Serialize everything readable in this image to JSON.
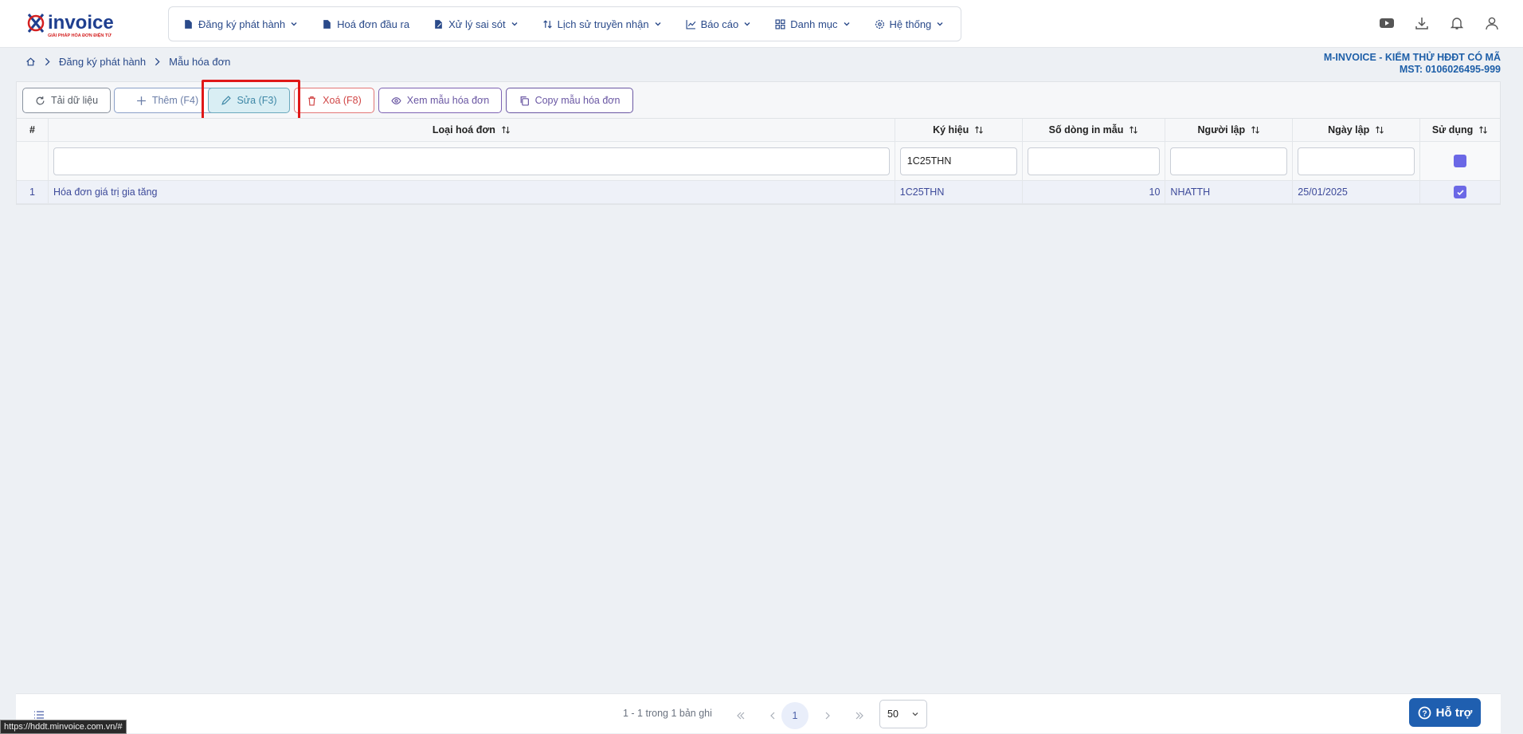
{
  "logo": {
    "brand": "invoice",
    "tagline": "GIẢI PHÁP HÓA ĐƠN ĐIỆN TỬ"
  },
  "nav": [
    {
      "label": "Đăng ký phát hành",
      "icon": "file-icon",
      "dropdown": true
    },
    {
      "label": "Hoá đơn đầu ra",
      "icon": "file-icon",
      "dropdown": false
    },
    {
      "label": "Xử lý sai sót",
      "icon": "file-edit-icon",
      "dropdown": true
    },
    {
      "label": "Lịch sử truyền nhận",
      "icon": "sort-icon",
      "dropdown": true
    },
    {
      "label": "Báo cáo",
      "icon": "chart-icon",
      "dropdown": true
    },
    {
      "label": "Danh mục",
      "icon": "grid-icon",
      "dropdown": true
    },
    {
      "label": "Hệ thống",
      "icon": "gear-icon",
      "dropdown": true
    }
  ],
  "breadcrumb": {
    "parent": "Đăng ký phát hành",
    "current": "Mẫu hóa đơn"
  },
  "company": {
    "name": "M-INVOICE - KIỂM THỬ HĐĐT CÓ MÃ",
    "tax": "MST: 0106026495-999"
  },
  "toolbar": {
    "reload": "Tải dữ liệu",
    "add": "Thêm (F4)",
    "edit": "Sửa (F3)",
    "delete": "Xoá (F8)",
    "view": "Xem mẫu hóa đơn",
    "copy": "Copy mẫu hóa đơn"
  },
  "table": {
    "headers": [
      "#",
      "Loại hoá đơn",
      "Ký hiệu",
      "Số dòng in mẫu",
      "Người lập",
      "Ngày lập",
      "Sử dụng"
    ],
    "filters": {
      "type": "",
      "symbol": "1C25THN",
      "lines": "",
      "creator": "",
      "date": ""
    },
    "rows": [
      {
        "no": "1",
        "type": "Hóa đơn giá trị gia tăng",
        "symbol": "1C25THN",
        "lines": "10",
        "creator": "NHATTH",
        "date": "25/01/2025",
        "used": true
      }
    ]
  },
  "footer": {
    "summary": "1 - 1 trong 1 bản ghi",
    "page": "1",
    "page_size": "50"
  },
  "help": "Hỗ trợ",
  "status_url": "https://hddt.minvoice.com.vn/#"
}
